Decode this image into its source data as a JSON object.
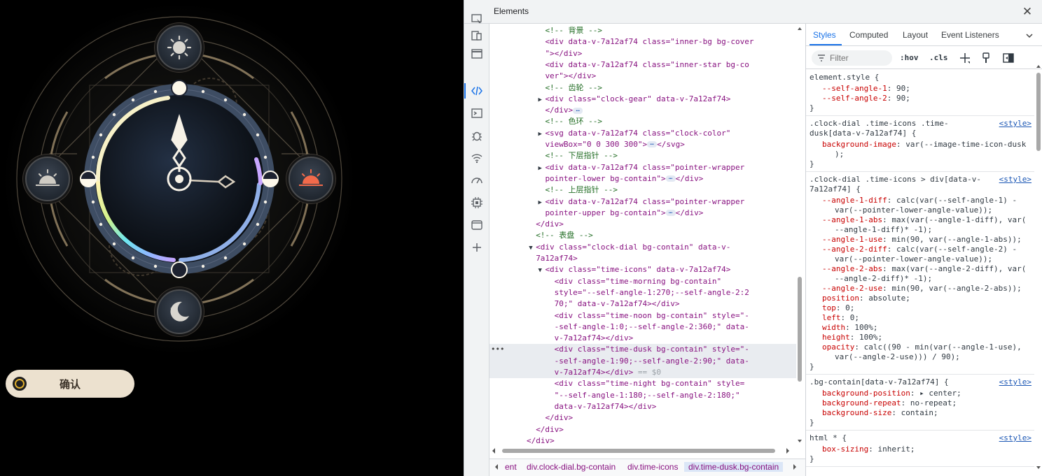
{
  "preview": {
    "confirm_label": "确认",
    "time_icons": [
      {
        "name": "time-morning",
        "icon": "sun-icon"
      },
      {
        "name": "time-noon",
        "icon": "sunrise-icon"
      },
      {
        "name": "time-dusk",
        "icon": "sunset-icon"
      },
      {
        "name": "time-night",
        "icon": "moon-icon"
      }
    ],
    "colors": {
      "dial_ring": "#3e4d63",
      "gold": "#c9b693",
      "sunset": "#f26a4b",
      "button_bg": "#ece1cf"
    }
  },
  "devtools": {
    "title": "Elements",
    "close": "✕",
    "dom_lines": [
      {
        "indent": 12,
        "tokens": [
          [
            "com",
            "<!-- 背景 -->"
          ]
        ]
      },
      {
        "indent": 12,
        "tokens": [
          [
            "tag",
            "<div "
          ],
          [
            "attr",
            "data-v-7a12af74 "
          ],
          [
            "attr",
            "class"
          ],
          [
            "tag",
            "=\""
          ],
          [
            "val",
            "inner-bg bg-cov"
          ],
          [
            "val",
            "er"
          ],
          [
            "tag",
            "\"></div>"
          ]
        ],
        "wrap": true,
        "text1": "<div data-v-7a12af74 class=\"inner-bg bg-cover",
        "text2": "\"></div>"
      },
      {
        "indent": 12,
        "tokens": [],
        "wrap": true,
        "text1": "<div data-v-7a12af74 class=\"inner-star bg-co",
        "text2": "ver\"></div>"
      },
      {
        "indent": 12,
        "tokens": [
          [
            "com",
            "<!-- 齿轮 -->"
          ]
        ]
      },
      {
        "indent": 12,
        "tri": true,
        "text1": "<div class=\"clock-gear\" data-v-7a12af74>",
        "text2": "</div>",
        "ellip": true
      },
      {
        "indent": 12,
        "tokens": [
          [
            "com",
            "<!-- 色环 -->"
          ]
        ]
      },
      {
        "indent": 12,
        "tri": true,
        "text1": "<svg data-v-7a12af74 class=\"clock-color\"",
        "text2": "viewBox=\"0 0 300 300\">",
        "ellip": true,
        "tail": "</svg>"
      },
      {
        "indent": 12,
        "tokens": [
          [
            "com",
            "<!-- 下层指针 -->"
          ]
        ]
      },
      {
        "indent": 12,
        "tri": true,
        "text1": "<div data-v-7a12af74 class=\"pointer-wrapper",
        "text2": "pointer-lower bg-contain\">",
        "ellip": true,
        "tail": "</div>"
      },
      {
        "indent": 12,
        "tokens": [
          [
            "com",
            "<!-- 上层指针 -->"
          ]
        ]
      },
      {
        "indent": 12,
        "tri": true,
        "text1": "<div data-v-7a12af74 class=\"pointer-wrapper",
        "text2": "pointer-upper bg-contain\">",
        "ellip": true,
        "tail": "</div>"
      },
      {
        "indent": 10,
        "text1": "</div>"
      },
      {
        "indent": 10,
        "tokens": [
          [
            "com",
            "<!-- 表盘 -->"
          ]
        ]
      },
      {
        "indent": 10,
        "tri": true,
        "open": true,
        "text1": "<div class=\"clock-dial bg-contain\" data-v-",
        "text2": "7a12af74>"
      },
      {
        "indent": 12,
        "tri": true,
        "open": true,
        "text1": "<div class=\"time-icons\" data-v-7a12af74>"
      },
      {
        "indent": 14,
        "text1": "<div class=\"time-morning bg-contain\"",
        "text2": "style=\"--self-angle-1:270;--self-angle-2:2",
        "text3": "70;\" data-v-7a12af74></div>"
      },
      {
        "indent": 14,
        "text1": "<div class=\"time-noon bg-contain\" style=\"-",
        "text2": "-self-angle-1:0;--self-angle-2:360;\" data-",
        "text3": "v-7a12af74></div>"
      },
      {
        "indent": 14,
        "sel": true,
        "text1": "<div class=\"time-dusk bg-contain\" style=\"-",
        "text2": "-self-angle-1:90;--self-angle-2:90;\" data-",
        "text3": "v-7a12af74></div>",
        "eq": "== $0"
      },
      {
        "indent": 14,
        "text1": "<div class=\"time-night bg-contain\" style=",
        "text2": "\"--self-angle-1:180;--self-angle-2:180;\"",
        "text3": "data-v-7a12af74></div>"
      },
      {
        "indent": 12,
        "text1": "</div>"
      },
      {
        "indent": 10,
        "text1": "</div>"
      },
      {
        "indent": 8,
        "text1": "</div>"
      }
    ],
    "breadcrumbs": [
      {
        "label": "ent"
      },
      {
        "label": "div.clock-dial.bg-contain"
      },
      {
        "label": "div.time-icons"
      },
      {
        "label": "div.time-dusk.bg-contain"
      }
    ],
    "tabs": [
      "Styles",
      "Computed",
      "Layout",
      "Event Listeners"
    ],
    "filter_placeholder": "Filter",
    "hov": ":hov",
    "cls": ".cls",
    "rules": [
      {
        "selector": [
          "element.style {"
        ],
        "source": "",
        "props": [
          [
            "--self-angle-1",
            "90;"
          ],
          [
            "--self-angle-2",
            "90;"
          ]
        ]
      },
      {
        "selector": [
          ".clock-dial .time-icons .time-",
          "dusk[data-v-7a12af74] {"
        ],
        "source": "<style>",
        "props": [
          [
            "background-image",
            "var(--image-time-icon-dusk",
            ");"
          ]
        ]
      },
      {
        "selector": [
          ".clock-dial .time-icons > div[data-v-",
          "7a12af74] {"
        ],
        "source": "<style>",
        "props": [
          [
            "--angle-1-diff",
            "calc(var(--self-angle-1) -",
            "var(--pointer-lower-angle-value));"
          ],
          [
            "--angle-1-abs",
            "max(var(--angle-1-diff), var(",
            "--angle-1-diff)* -1);"
          ],
          [
            "--angle-1-use",
            "min(90, var(--angle-1-abs));"
          ],
          [
            "--angle-2-diff",
            "calc(var(--self-angle-2) -",
            "var(--pointer-lower-angle-value));"
          ],
          [
            "--angle-2-abs",
            "max(var(--angle-2-diff), var(",
            "--angle-2-diff)* -1);"
          ],
          [
            "--angle-2-use",
            "min(90, var(--angle-2-abs));"
          ],
          [
            "position",
            "absolute;"
          ],
          [
            "top",
            "0;"
          ],
          [
            "left",
            "0;"
          ],
          [
            "width",
            "100%;"
          ],
          [
            "height",
            "100%;"
          ],
          [
            "opacity",
            "calc((90 - min(var(--angle-1-use),",
            "var(--angle-2-use))) / 90);"
          ]
        ]
      },
      {
        "selector": [
          ".bg-contain[data-v-7a12af74] {"
        ],
        "source": "<style>",
        "props": [
          [
            "background-position",
            "▸ center;"
          ],
          [
            "background-repeat",
            "no-repeat;"
          ],
          [
            "background-size",
            "contain;"
          ]
        ]
      },
      {
        "selector": [
          "html * {"
        ],
        "source": "<style>",
        "props": [
          [
            "box-sizing",
            "inherit;"
          ]
        ]
      }
    ]
  }
}
